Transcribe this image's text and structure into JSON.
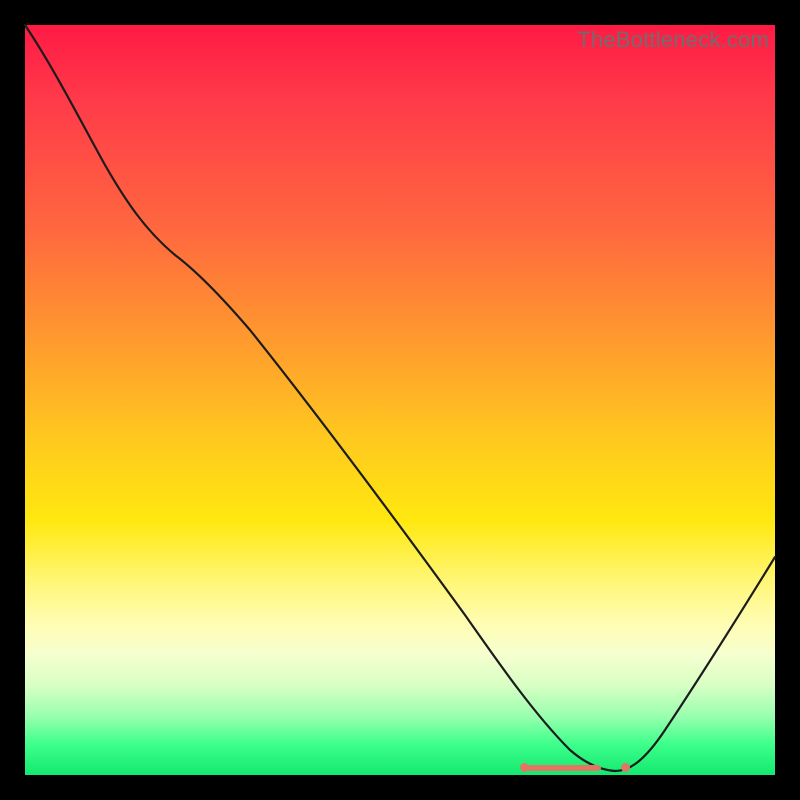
{
  "watermark": "TheBottleneck.com",
  "chart_data": {
    "type": "line",
    "title": "",
    "xlabel": "",
    "ylabel": "",
    "xlim": [
      0,
      100
    ],
    "ylim": [
      0,
      100
    ],
    "grid": false,
    "legend": false,
    "background_gradient": {
      "stops": [
        {
          "pos": 0.0,
          "color": "#ff1a44"
        },
        {
          "pos": 0.28,
          "color": "#ff6a3e"
        },
        {
          "pos": 0.55,
          "color": "#ffc81f"
        },
        {
          "pos": 0.74,
          "color": "#fff674"
        },
        {
          "pos": 0.88,
          "color": "#d8ffc4"
        },
        {
          "pos": 1.0,
          "color": "#14e870"
        }
      ]
    },
    "series": [
      {
        "name": "bottleneck-curve",
        "x": [
          0,
          8,
          14,
          20,
          28,
          40,
          55,
          66,
          72,
          76,
          80,
          86,
          92,
          100
        ],
        "values": [
          100,
          90,
          80,
          73,
          64,
          48,
          28,
          13,
          5,
          1,
          0,
          9,
          21,
          38
        ]
      }
    ],
    "markers": {
      "run": {
        "x_start": 66,
        "x_end": 76,
        "y": 0.5
      },
      "dot": {
        "x": 80,
        "y": 0.5
      }
    },
    "annotations": []
  }
}
